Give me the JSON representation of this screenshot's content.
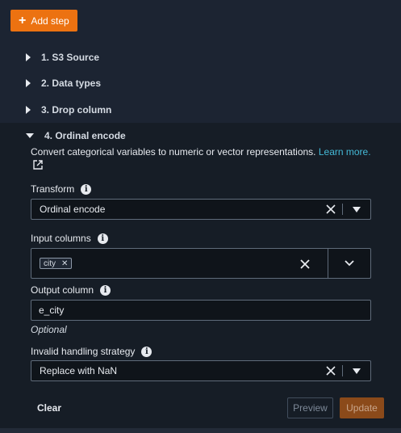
{
  "toolbar": {
    "add_step_label": "Add step"
  },
  "steps": [
    {
      "label": "1. S3 Source"
    },
    {
      "label": "2. Data types"
    },
    {
      "label": "3. Drop column"
    },
    {
      "label": "4. Ordinal encode"
    }
  ],
  "panel": {
    "description": "Convert categorical variables to numeric or vector representations.",
    "learn_more": "Learn more.",
    "transform": {
      "label": "Transform",
      "value": "Ordinal encode"
    },
    "input_columns": {
      "label": "Input columns",
      "tokens": [
        "city"
      ]
    },
    "output_column": {
      "label": "Output column",
      "value": "e_city",
      "hint": "Optional"
    },
    "invalid_handling": {
      "label": "Invalid handling strategy",
      "value": "Replace with NaN"
    }
  },
  "actions": {
    "clear": "Clear",
    "preview": "Preview",
    "update": "Update"
  },
  "colors": {
    "accent": "#ec7211",
    "link": "#44b9d6",
    "background": "#161d26"
  }
}
